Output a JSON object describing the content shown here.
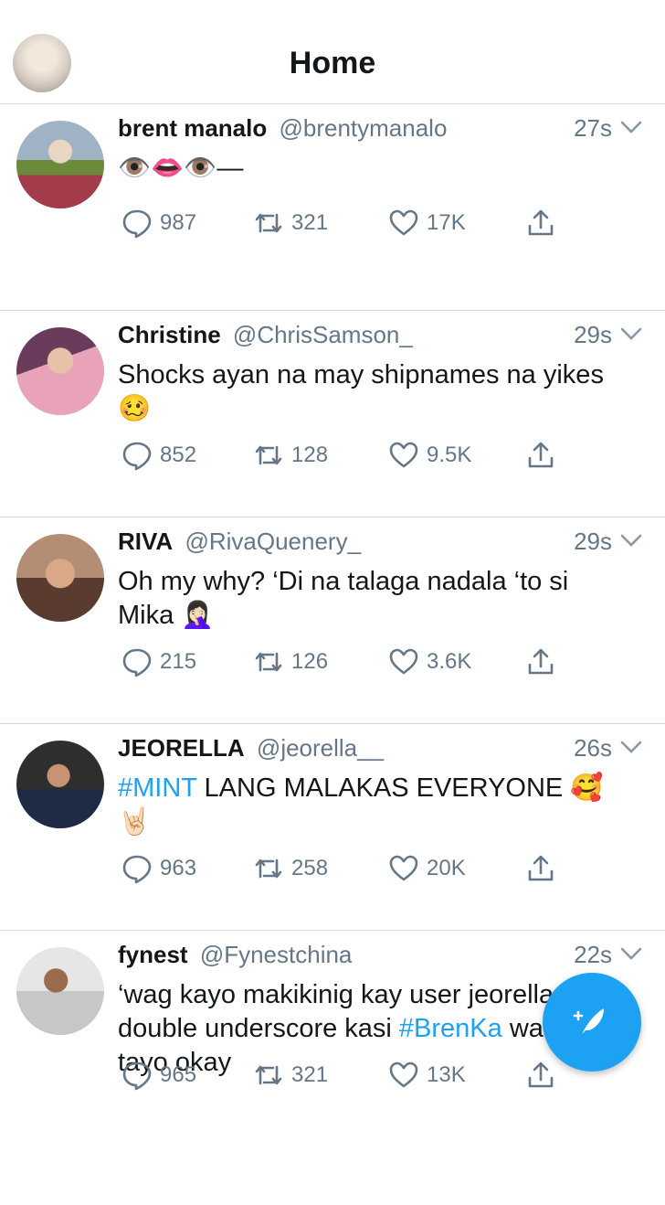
{
  "header": {
    "title": "Home",
    "avatar_icon": "profile-avatar"
  },
  "colors": {
    "accent": "#1da1f2",
    "text": "#14171a",
    "secondary": "#657786",
    "divider": "#d4d6d8"
  },
  "tweets": [
    {
      "name": "brent manalo",
      "handle": "@brentymanalo",
      "time": "27s",
      "text": "👁️👄👁️—",
      "reply_count": "987",
      "retweet_count": "321",
      "like_count": "17K"
    },
    {
      "name": "Christine",
      "handle": "@ChrisSamson_",
      "time": "29s",
      "text": "Shocks ayan na may shipnames na yikes 🥴",
      "reply_count": "852",
      "retweet_count": "128",
      "like_count": "9.5K"
    },
    {
      "name": "RIVA",
      "handle": "@RivaQuenery_",
      "time": "29s",
      "text": "Oh my why? ‘Di na talaga nadala ‘to si Mika 🤦🏻‍♀️",
      "reply_count": "215",
      "retweet_count": "126",
      "like_count": "3.6K"
    },
    {
      "name": "JEORELLA",
      "handle": "@jeorella__",
      "time": "26s",
      "hashtag": "#MINT",
      "text": " LANG MALAKAS EVERYONE 🥰 🤘🏻",
      "reply_count": "963",
      "retweet_count": "258",
      "like_count": "20K"
    },
    {
      "name": "fynest",
      "handle": "@Fynestchina",
      "time": "22s",
      "text_before": "‘wag kayo makikinig kay user jeorella double underscore kasi ",
      "hashtag": "#BrenKa",
      "text_after": " warriors tayo okay",
      "reply_count": "965",
      "retweet_count": "321",
      "like_count": "13K"
    }
  ],
  "compose": {
    "icon": "compose-feather-icon"
  }
}
